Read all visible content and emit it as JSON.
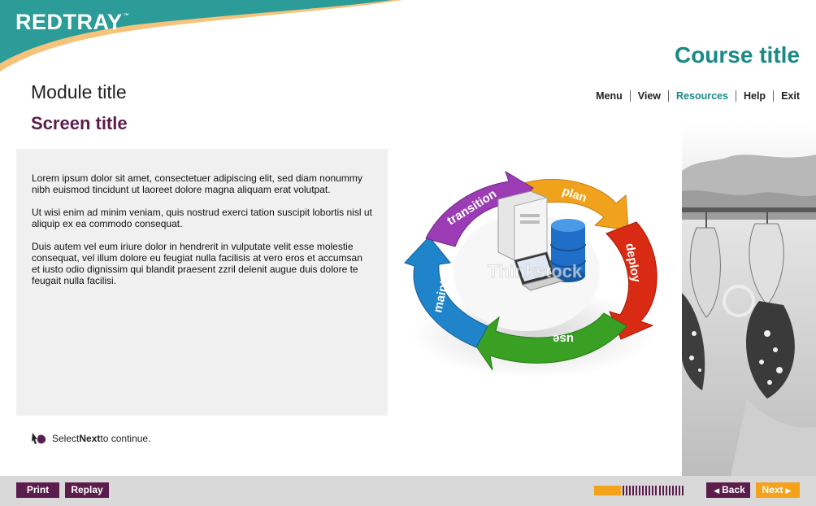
{
  "brand": {
    "logo_text": "REDTRAY",
    "tm": "™"
  },
  "header": {
    "course_title": "Course title",
    "module_title": "Module title",
    "screen_title": "Screen title"
  },
  "nav": {
    "menu": "Menu",
    "view": "View",
    "resources": "Resources",
    "help": "Help",
    "exit": "Exit",
    "active": "Resources"
  },
  "content": {
    "paragraphs": [
      "Lorem ipsum dolor sit amet, consectetuer adipiscing elit, sed diam nonummy nibh euismod tincidunt ut laoreet dolore magna aliquam erat volutpat.",
      "Ut wisi enim ad minim veniam, quis nostrud exerci tation suscipit lobortis nisl ut aliquip ex ea commodo consequat.",
      "Duis autem vel eum iriure dolor in hendrerit in vulputate velit esse molestie consequat, vel illum dolore eu feugiat nulla facilisis at vero eros et accumsan et iusto odio dignissim qui blandit praesent  zzril delenit augue duis dolore te feugait nulla facilisi."
    ]
  },
  "diagram": {
    "segments": [
      "plan",
      "deploy",
      "use",
      "maintain",
      "transition"
    ],
    "watermark": "Thinkstock",
    "colors": {
      "plan": "#f0a21c",
      "deploy": "#d92a13",
      "use": "#3aa023",
      "maintain": "#1f84c9",
      "transition": "#9b3cb5"
    }
  },
  "instruction": {
    "prefix": "Select ",
    "bold": "Next",
    "suffix": " to continue."
  },
  "footer": {
    "print": "Print",
    "replay": "Replay",
    "back": "Back",
    "next": "Next",
    "progress_fraction": 0.3
  },
  "colors": {
    "teal": "#1a8a86",
    "plum": "#5b1d4b",
    "orange": "#f5a21b",
    "footer_bg": "#d9d9d9"
  },
  "icons": [
    "cursor-hand-icon",
    "triangle-left-icon",
    "triangle-right-icon"
  ]
}
